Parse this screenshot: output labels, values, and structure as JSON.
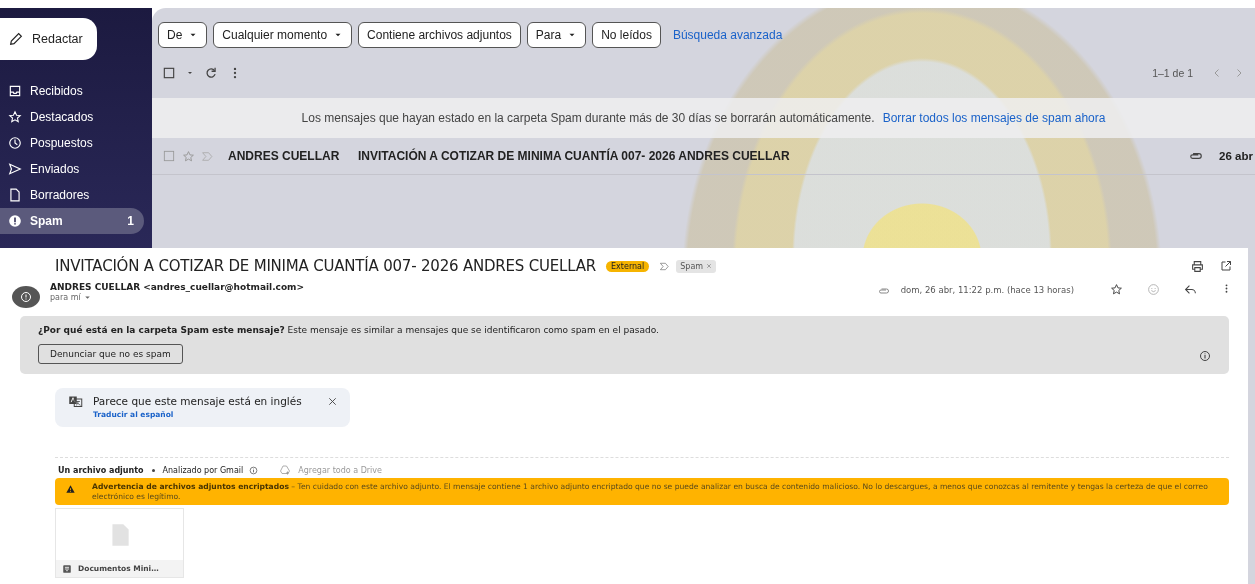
{
  "sidebar": {
    "compose": "Redactar",
    "items": [
      {
        "label": "Recibidos",
        "selected": false
      },
      {
        "label": "Destacados",
        "selected": false
      },
      {
        "label": "Pospuestos",
        "selected": false
      },
      {
        "label": "Enviados",
        "selected": false
      },
      {
        "label": "Borradores",
        "selected": false
      },
      {
        "label": "Spam",
        "selected": true,
        "count": "1"
      }
    ]
  },
  "filters": [
    {
      "label": "De",
      "dropdown": true
    },
    {
      "label": "Cualquier momento",
      "dropdown": true
    },
    {
      "label": "Contiene archivos adjuntos",
      "dropdown": false
    },
    {
      "label": "Para",
      "dropdown": true
    },
    {
      "label": "No leídos",
      "dropdown": false
    }
  ],
  "advanced_search": "Búsqueda avanzada",
  "pagination": "1–1 de 1",
  "spam_banner": {
    "text": "Los mensajes que hayan estado en la carpeta Spam durante más de 30 días se borrarán automáticamente.",
    "link": "Borrar todos los mensajes de spam ahora"
  },
  "rows": [
    {
      "checked": false,
      "starred": false,
      "sender": "ANDRES CUELLAR",
      "subject": "INVITACIÓN A COTIZAR DE MINIMA CUANTÍA 007- 2026 ANDRES CUELLAR",
      "has_attachment": true,
      "date": "26 abr"
    }
  ],
  "message": {
    "subject": "INVITACIÓN A COTIZAR DE MINIMA CUANTÍA 007- 2026 ANDRES CUELLAR",
    "labels": [
      {
        "text": "External",
        "kind": "external"
      },
      {
        "text": "Spam",
        "kind": "folder"
      }
    ],
    "sender": "ANDRES CUELLAR <andres_cuellar@hotmail.com>",
    "recipient": "para mí",
    "date": "dom, 26 abr, 11:22 p.m. (hace 13 horas)",
    "starred": false,
    "spam_notice": {
      "text": "**¿Por qué está en la carpeta Spam este mensaje?** Este mensaje es similar a mensajes que se identificaron como spam en el pasado.",
      "button": "Denunciar que no es spam"
    },
    "translate": {
      "text": "Parece que este mensaje está en inglés",
      "link": "Traducir al español"
    },
    "attachments": {
      "heading": "Un archivo adjunto",
      "scan": "Analizado por Gmail",
      "drive": "Agregar todo a Drive",
      "warning": "**Advertencia de archivos adjuntos encriptados** – Ten cuidado con este archivo adjunto. El mensaje contiene 1 archivo adjunto encriptado que no se puede analizar en busca de contenido malicioso. No lo descargues, a menos que conozcas al remitente y tengas la certeza de que el correo electrónico es legítimo.",
      "files": [
        {
          "name": "Documentos Mini…"
        }
      ]
    }
  }
}
